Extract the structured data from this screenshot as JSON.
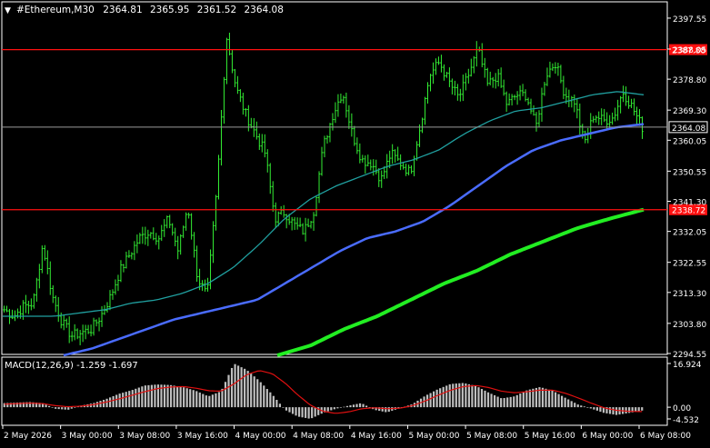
{
  "header": {
    "symbol_label": "#Ethereum,M30",
    "ohlc": [
      "2364.81",
      "2365.95",
      "2361.52",
      "2364.08"
    ],
    "menu_glyph": "▼"
  },
  "colors": {
    "background": "#000000",
    "bull_bar": "#33ee33",
    "bear_bar": "#33ee33",
    "ma_fast": "#20a0a0",
    "ma_mid": "#4a6cff",
    "ma_slow": "#22ee22",
    "hline": "#ff1010",
    "hline_label_bg": "#ff1010",
    "price_label_bg": "#000000",
    "macd_hist": "#bfbfbf",
    "macd_signal": "#e01010",
    "axis_text": "#ffffff",
    "frame": "#ffffff"
  },
  "price_axis": {
    "min": 2294.55,
    "max": 2402.0,
    "ticks": [
      "2397.55",
      "2388.05",
      "2378.80",
      "2369.30",
      "2360.05",
      "2350.55",
      "2341.30",
      "2332.05",
      "2322.55",
      "2313.30",
      "2303.80",
      "2294.55"
    ]
  },
  "horizontal_lines": [
    {
      "price": 2387.88,
      "label": "2387.88"
    },
    {
      "price": 2338.72,
      "label": "2338.72"
    }
  ],
  "current_price": {
    "price": 2364.08,
    "label": "2364.08"
  },
  "time_axis": {
    "labels": [
      "2 May 2026",
      "3 May 00:00",
      "3 May 08:00",
      "3 May 16:00",
      "4 May 00:00",
      "4 May 08:00",
      "4 May 16:00",
      "5 May 00:00",
      "5 May 08:00",
      "5 May 16:00",
      "6 May 00:00",
      "6 May 08:00"
    ]
  },
  "macd": {
    "label": "MACD(12,26,9) -1.259 -1.697",
    "axis": {
      "max": 16.924,
      "min": -4.532,
      "zero": 0.0
    },
    "ticks": [
      "16.924",
      "0.00",
      "-4.532"
    ]
  },
  "chart_data": {
    "type": "bar",
    "symbol": "#Ethereum",
    "timeframe": "M30",
    "ylim": [
      2294.55,
      2402.0
    ],
    "x_labels": [
      "2 May 2026",
      "3 May 00:00",
      "3 May 08:00",
      "3 May 16:00",
      "4 May 00:00",
      "4 May 08:00",
      "4 May 16:00",
      "5 May 00:00",
      "5 May 08:00",
      "5 May 16:00",
      "6 May 00:00",
      "6 May 08:00"
    ],
    "close_keypoints": [
      2308,
      2306,
      2309,
      2310,
      2328,
      2312,
      2304,
      2300,
      2301,
      2302,
      2306,
      2312,
      2320,
      2325,
      2330,
      2332,
      2330,
      2336,
      2326,
      2340,
      2318,
      2312,
      2345,
      2392,
      2376,
      2368,
      2362,
      2356,
      2336,
      2338,
      2334,
      2332,
      2338,
      2358,
      2368,
      2375,
      2362,
      2354,
      2353,
      2348,
      2356,
      2353,
      2350,
      2364,
      2380,
      2384,
      2378,
      2373,
      2380,
      2388,
      2377,
      2380,
      2371,
      2374,
      2374,
      2364,
      2380,
      2384,
      2374,
      2372,
      2359,
      2368,
      2366,
      2367,
      2375,
      2370,
      2364
    ],
    "ma_fast_keypoints": [
      2306,
      2306,
      2306,
      2307,
      2308,
      2310,
      2311,
      2313,
      2316,
      2321,
      2328,
      2336,
      2342,
      2346,
      2349,
      2352,
      2354,
      2357,
      2362,
      2366,
      2369,
      2370,
      2372,
      2374,
      2375,
      2374
    ],
    "ma_mid_keypoints": [
      2294,
      2296,
      2299,
      2302,
      2305,
      2307,
      2309,
      2311,
      2316,
      2321,
      2326,
      2330,
      2332,
      2335,
      2340,
      2346,
      2352,
      2357,
      2360,
      2362,
      2364,
      2365
    ],
    "ma_slow_keypoints": [
      2294,
      2297,
      2302,
      2306,
      2311,
      2316,
      2320,
      2325,
      2329,
      2333,
      2336,
      2338.72
    ],
    "macd_hist_keypoints": [
      1.6,
      1.8,
      2.0,
      1.6,
      -0.6,
      -1.0,
      0.6,
      1.6,
      3.2,
      5.2,
      6.6,
      8.4,
      8.8,
      8.6,
      7.8,
      6.4,
      4.2,
      6.2,
      16.9,
      14.5,
      10.2,
      5.0,
      -1.0,
      -3.6,
      -4.5,
      -2.2,
      -0.6,
      0.6,
      1.6,
      -1.0,
      -2.0,
      -0.4,
      1.2,
      4.4,
      7.0,
      9.0,
      9.4,
      8.2,
      5.6,
      3.4,
      4.2,
      6.6,
      7.8,
      6.4,
      3.6,
      1.0,
      -0.5,
      -2.2,
      -3.0,
      -2.2,
      -1.3
    ],
    "macd_signal_keypoints": [
      1.2,
      1.4,
      1.6,
      1.4,
      0.6,
      0.2,
      0.4,
      1.0,
      2.0,
      3.2,
      4.6,
      6.0,
      7.2,
      7.8,
      8.0,
      7.4,
      6.4,
      6.2,
      9.0,
      12.6,
      14.2,
      13.0,
      9.4,
      4.8,
      0.8,
      -1.6,
      -2.4,
      -1.8,
      -0.6,
      -0.2,
      -0.6,
      -0.4,
      0.6,
      2.4,
      4.6,
      6.6,
      8.0,
      8.4,
      7.6,
      6.2,
      5.6,
      6.0,
      6.6,
      6.6,
      5.4,
      3.6,
      1.6,
      -0.2,
      -1.2,
      -1.6,
      -1.7
    ]
  }
}
